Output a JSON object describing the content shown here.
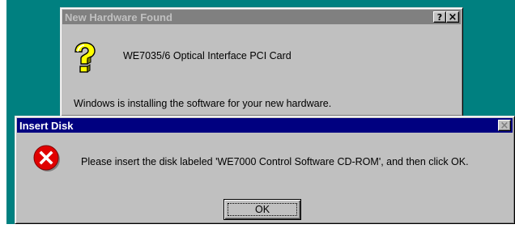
{
  "hardware_dialog": {
    "title": "New Hardware Found",
    "help_button": "?",
    "close_button": "×",
    "device_name": "WE7035/6 Optical Interface PCI Card",
    "status_message": "Windows is installing the software for your new hardware."
  },
  "insert_disk_dialog": {
    "title": "Insert Disk",
    "close_button": "×",
    "message": "Please insert the disk labeled 'WE7000 Control Software CD-ROM', and then click OK.",
    "ok_label": "OK"
  },
  "colors": {
    "desktop": "#008080",
    "active_titlebar": "#000080",
    "inactive_titlebar": "#808080",
    "window_face": "#c0c0c0",
    "error_icon": "#e00000"
  }
}
